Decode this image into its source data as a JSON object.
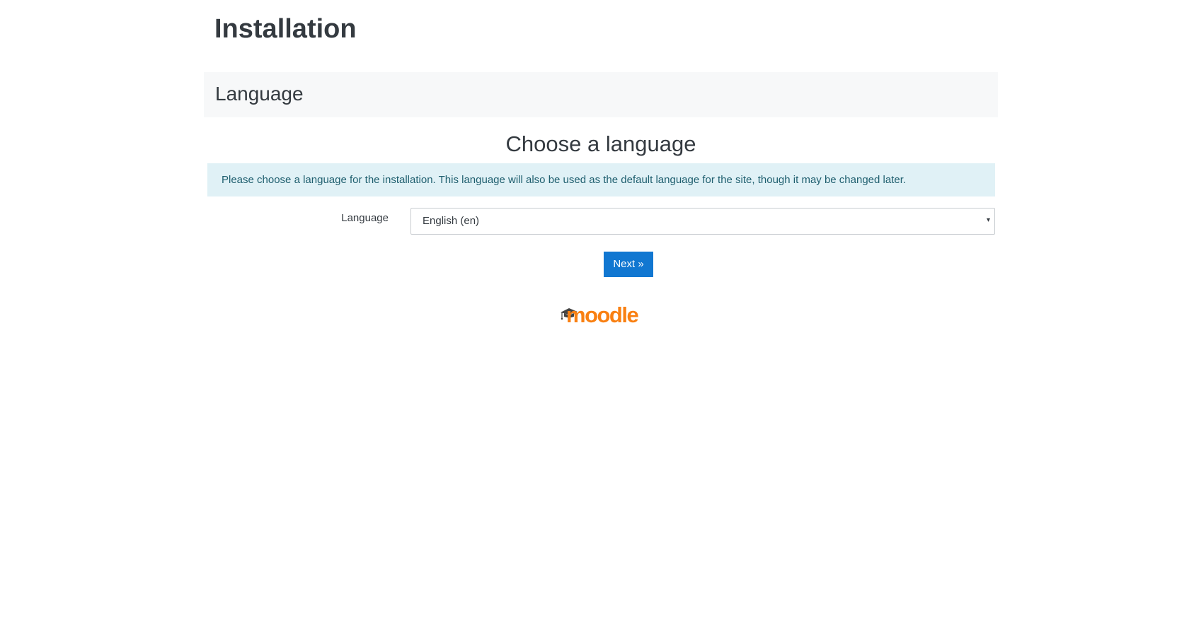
{
  "header": {
    "title": "Installation"
  },
  "stage": {
    "title": "Language"
  },
  "main": {
    "heading": "Choose a language",
    "info": "Please choose a language for the installation. This language will also be used as the default language for the site, though it may be changed later.",
    "language_field": {
      "label": "Language",
      "selected": "English (en)",
      "arrow": "▾"
    },
    "next_label": "Next »"
  },
  "footer": {
    "logo_text": "moodle",
    "logo_icon": "graduation-cap-icon"
  },
  "colors": {
    "accent": "#1177d1",
    "info_bg": "#e0f1f6",
    "info_text": "#1e5e6e",
    "logo_orange": "#f98012"
  }
}
